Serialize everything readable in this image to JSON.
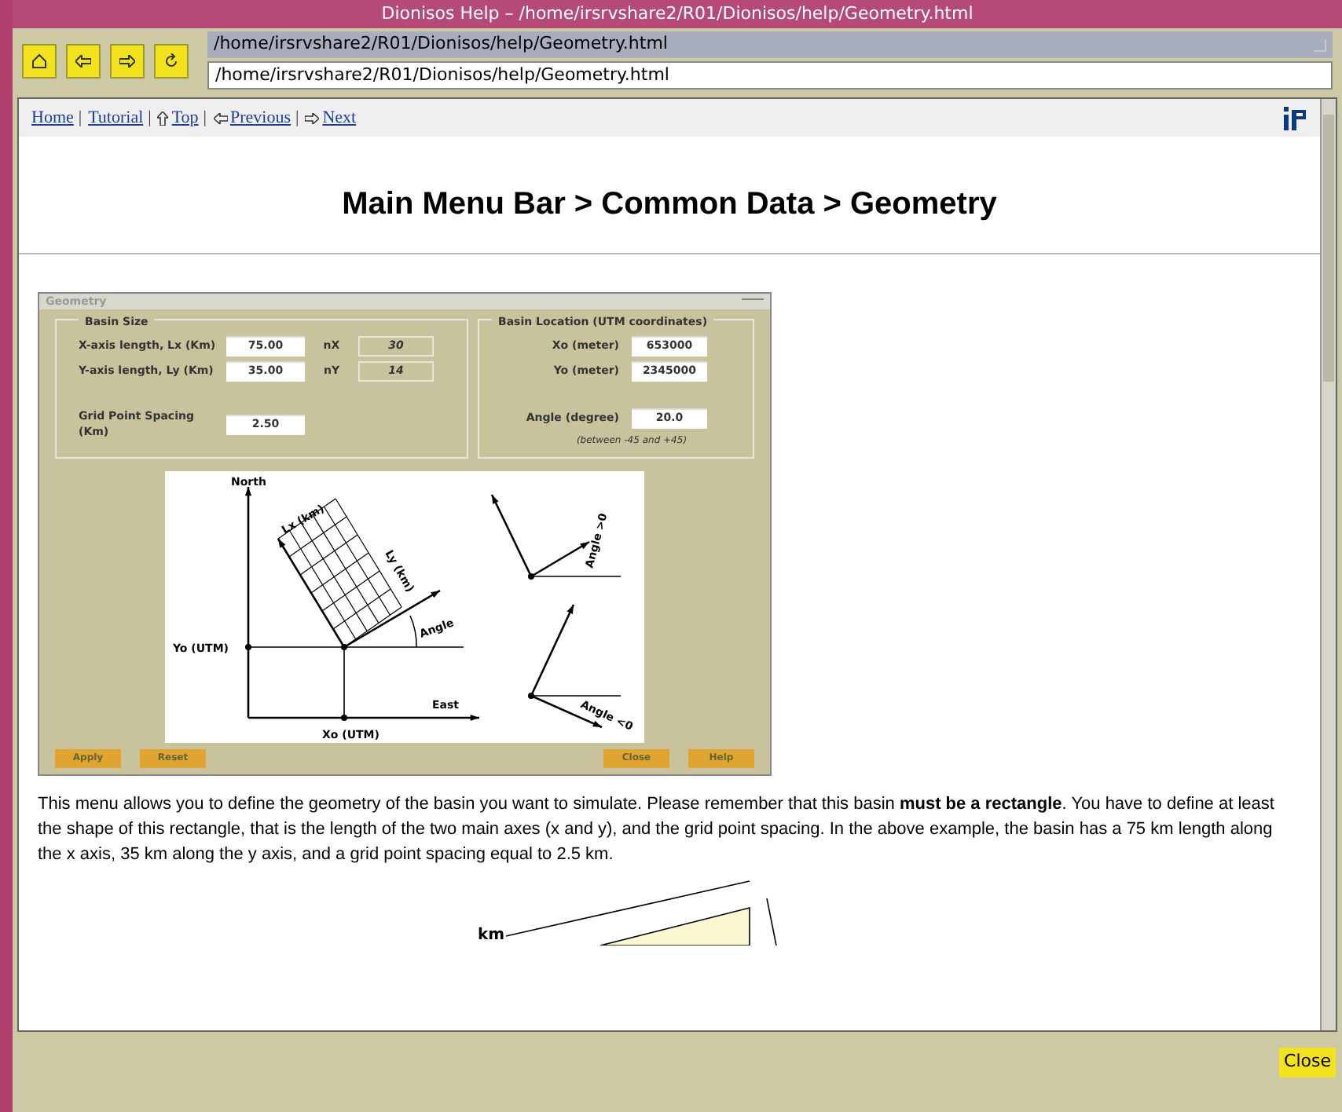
{
  "window": {
    "title": "Dionisos Help – /home/irsrvshare2/R01/Dionisos/help/Geometry.html"
  },
  "location": {
    "history_value": "/home/irsrvshare2/R01/Dionisos/help/Geometry.html",
    "value": "/home/irsrvshare2/R01/Dionisos/help/Geometry.html"
  },
  "nav": {
    "separator": "|",
    "links": [
      {
        "label": "Home",
        "kind": "plain"
      },
      {
        "label": "Tutorial",
        "kind": "plain"
      },
      {
        "label": "Top",
        "kind": "up"
      },
      {
        "label": "Previous",
        "kind": "left"
      },
      {
        "label": "Next",
        "kind": "right"
      }
    ]
  },
  "heading": "Main Menu Bar > Common Data > Geometry",
  "app_window": {
    "title": "Geometry",
    "basin_size": {
      "title": "Basin Size",
      "rows": [
        {
          "label": "X-axis length, Lx (Km)",
          "value": "75.00",
          "count_label": "nX",
          "count": "30"
        },
        {
          "label": "Y-axis length, Ly (Km)",
          "value": "35.00",
          "count_label": "nY",
          "count": "14"
        }
      ],
      "spacing_label": "Grid Point Spacing (Km)",
      "spacing_value": "2.50"
    },
    "basin_location": {
      "title": "Basin Location (UTM coordinates)",
      "rows": [
        {
          "label": "Xo (meter)",
          "value": "653000"
        },
        {
          "label": "Yo (meter)",
          "value": "2345000"
        }
      ],
      "angle_label": "Angle (degree)",
      "angle_value": "20.0",
      "angle_hint": "(between -45 and +45)"
    },
    "diagram_labels": {
      "north": "North",
      "lx": "Lx (km)",
      "ly": "Ly (km)",
      "angle": "Angle",
      "yo": "Yo (UTM)",
      "east": "East",
      "xo": "Xo (UTM)",
      "angle_pos": "Angle >0",
      "angle_neg": "Angle <0"
    },
    "left_buttons": [
      "Apply",
      "Reset"
    ],
    "right_buttons": [
      "Close",
      "Help"
    ]
  },
  "paragraph": "This menu allows you to define the geometry of the basin you want to simulate. Please remember that this basin **must be a rectangle**. You have to define at least the shape of this rectangle, that is the length of the two main axes (x and y), and the grid point spacing. In the above example, the basin has a 75 km length along the x axis, 35 km along the y axis, and a grid point spacing equal to 2.5 km.",
  "figure_label": "km",
  "close_button": "Close"
}
